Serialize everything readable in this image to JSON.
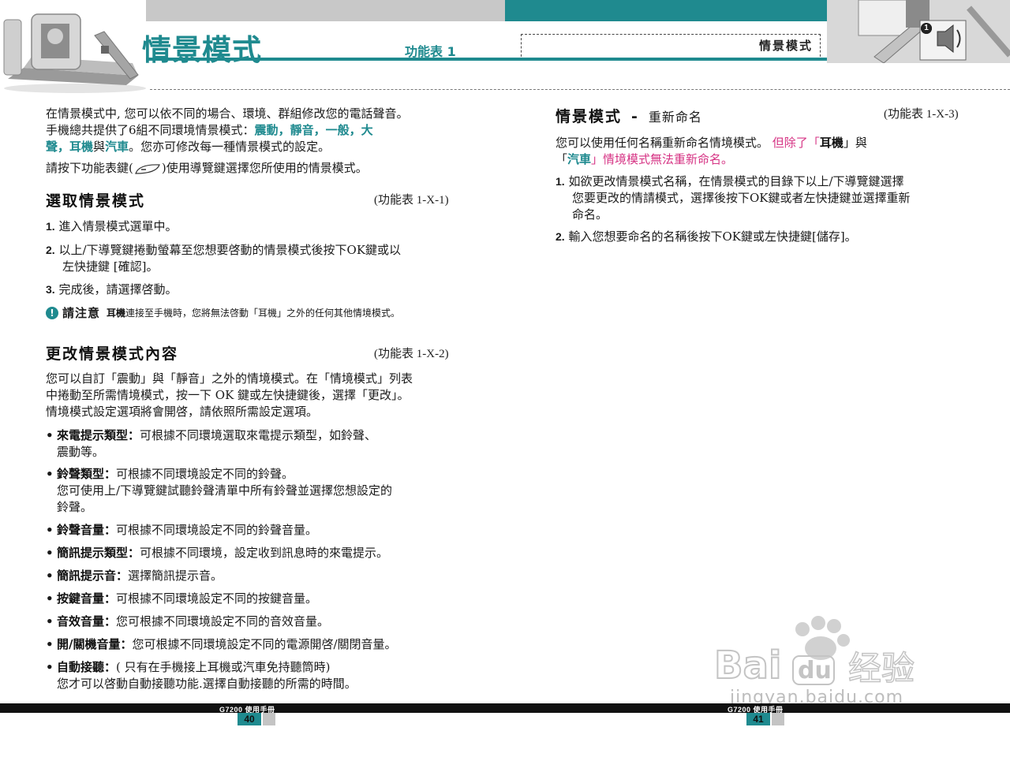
{
  "header": {
    "title": "情景模式",
    "menu_ref": "功能表 1",
    "right_title": "情景模式",
    "right_badge_number": "1"
  },
  "left": {
    "intro_1": "在情景模式中, 您可以依不同的場合、環境、群組修改您的電話聲音。",
    "intro_2a": "手機總共提供了6組不同環境情景模式：",
    "intro_modes": [
      "震動",
      "靜音",
      "一般",
      "大聲",
      "耳機",
      "汽車"
    ],
    "intro_2_sep1": "，",
    "intro_2_and": "與",
    "intro_2_end": "。您亦可修改每一種情景模式的設定。",
    "intro_3a": "請按下功能表鍵(",
    "intro_3b": ")使用導覽鍵選擇您所使用的情景模式。",
    "select": {
      "heading": "選取情景模式",
      "ref": "(功能表 1-X-1)",
      "steps": [
        {
          "num": "1.",
          "text": "進入情景模式選單中。"
        },
        {
          "num": "2.",
          "text": "以上/下導覽鍵捲動螢幕至您想要啓動的情景模式後按下OK鍵或以",
          "text2": "左快捷鍵 [確認]。"
        },
        {
          "num": "3.",
          "text": "完成後，請選擇啓動。"
        }
      ],
      "note_label": "請注意",
      "note_bold": "耳機",
      "note_text": "連接至手機時，您將無法啓動「耳機」之外的任何其他情境模式。"
    },
    "edit": {
      "heading": "更改情景模式內容",
      "ref": "(功能表 1-X-2)",
      "para": [
        "您可以自訂「震動」與「靜音」之外的情境模式。在「情境模式」列表",
        "中捲動至所需情境模式，按一下 OK 鍵或左快捷鍵後，選擇「更改」。",
        "情境模式設定選項將會開啓，請依照所需設定選項。"
      ],
      "items": [
        {
          "label": "來電提示類型",
          "text": "可根據不同環境選取來電提示類型，如鈴聲、",
          "text2": "震動等。"
        },
        {
          "label": "鈴聲類型",
          "text": "可根據不同環境設定不同的鈴聲。",
          "text2": "您可使用上/下導覽鍵試聽鈴聲清單中所有鈴聲並選擇您想設定的",
          "text3": "鈴聲。"
        },
        {
          "label": "鈴聲音量",
          "text": "可根據不同環境設定不同的鈴聲音量。"
        },
        {
          "label": "簡訊提示類型",
          "text": "可根據不同環境，設定收到訊息時的來電提示。"
        },
        {
          "label": "簡訊提示音",
          "text": "選擇簡訊提示音。"
        },
        {
          "label": "按鍵音量",
          "text": "可根據不同環境設定不同的按鍵音量。"
        },
        {
          "label": "音效音量",
          "text": "您可根據不同環境設定不同的音效音量。"
        },
        {
          "label": "開/關機音量",
          "text": "您可根據不同環境設定不同的電源開啓/關閉音量。"
        },
        {
          "label": "自動接聽",
          "text": "( 只有在手機接上耳機或汽車免持聽筒時)",
          "text2": "您才可以啓動自動接聽功能.選擇自動接聽的所需的時間。"
        }
      ],
      "colon": "："
    }
  },
  "right": {
    "heading": "情景模式",
    "dash": "-",
    "subheading": "重新命名",
    "ref": "(功能表 1-X-3)",
    "para_1": "您可以使用任何名稱重新命名情境模式。",
    "para_pink_1": "但除了「",
    "para_bold_1": "耳機",
    "para_pink_2": "」與",
    "para_pink_3": "「",
    "para_bold_2": "汽車",
    "para_pink_4": "」情境模式無法重新命名。",
    "steps": [
      {
        "num": "1.",
        "text": "如欲更改情景模式名稱，在情景模式的目錄下以上/下導覽鍵選擇",
        "text2": "您要更改的情請模式，選擇後按下OK鍵或者左快捷鍵並選擇重新",
        "text3": "命名。"
      },
      {
        "num": "2.",
        "text": "輸入您想要命名的名稱後按下OK鍵或左快捷鍵[儲存]。"
      }
    ]
  },
  "footer": {
    "left_label": "G7200 使用手冊",
    "left_page": "40",
    "right_label": "G7200 使用手冊",
    "right_page": "41"
  },
  "watermark": {
    "logo_text": "Bai du 经验",
    "url": "jingyan.baidu.com"
  },
  "colors": {
    "accent": "#1f8a8f",
    "pink": "#d63384"
  }
}
